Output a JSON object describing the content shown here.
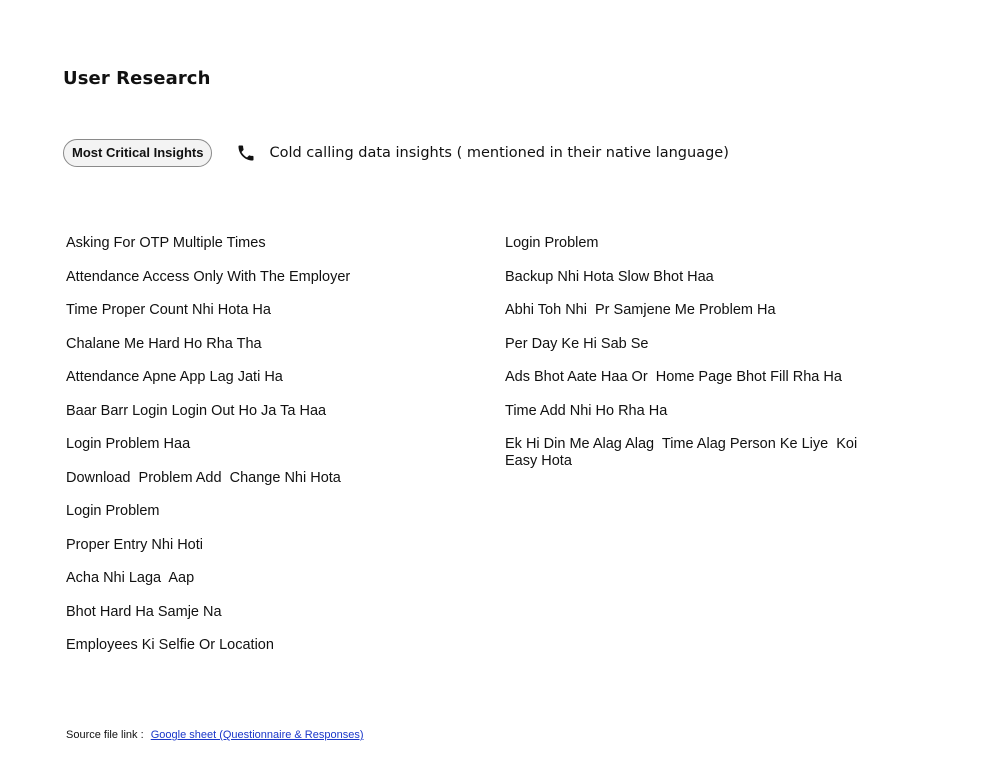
{
  "page": {
    "title": "User Research"
  },
  "insights_header": {
    "pill_label": "Most Critical Insights",
    "icon": "phone-icon",
    "caption": "Cold calling data insights ( mentioned in their native language)"
  },
  "insights": {
    "left": [
      "Asking For OTP Multiple Times",
      "Attendance Access Only With The Employer",
      "Time Proper Count Nhi Hota Ha",
      "Chalane Me Hard Ho Rha Tha",
      "Attendance Apne App Lag Jati Ha",
      "Baar Barr Login Login Out Ho Ja Ta Haa",
      "Login Problem Haa",
      "Download  Problem Add  Change Nhi Hota",
      "Login Problem",
      "Proper Entry Nhi Hoti",
      "Acha Nhi Laga  Aap",
      "Bhot Hard Ha Samje Na",
      "Employees Ki Selfie Or Location"
    ],
    "right": [
      "Login Problem",
      "Backup Nhi Hota Slow Bhot Haa",
      "Abhi Toh Nhi  Pr Samjene Me Problem Ha",
      "Per Day Ke Hi Sab Se",
      "Ads Bhot Aate Haa Or  Home Page Bhot Fill Rha Ha",
      "Time Add Nhi Ho Rha Ha",
      "Ek Hi Din Me Alag Alag  Time Alag Person Ke Liye  Koi Easy Hota"
    ]
  },
  "source": {
    "label": "Source file link :",
    "link_text": "Google sheet (Questionnaire & Responses)"
  },
  "colors": {
    "text": "#111111",
    "pill_border": "#8a8a8a",
    "pill_background": "#f3f3f3",
    "link": "#1a37c9"
  }
}
